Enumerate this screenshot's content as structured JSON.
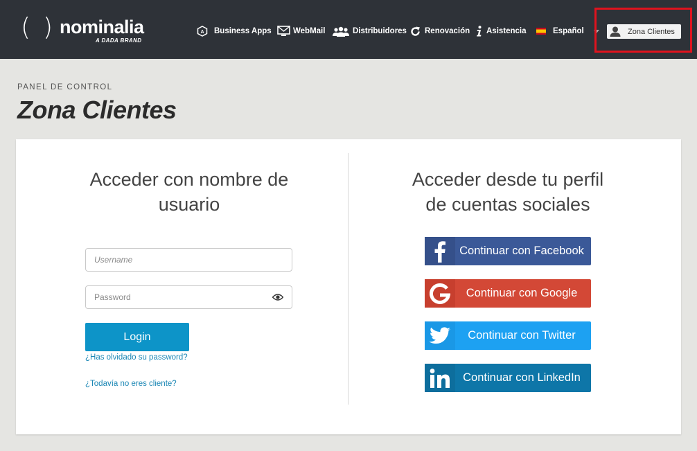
{
  "header": {
    "logo_text": "nominalia",
    "logo_tagline": "A DADA BRAND",
    "nav": [
      {
        "label": "Business Apps",
        "icon": "business-apps-icon"
      },
      {
        "label": "WebMail",
        "icon": "mail-icon"
      },
      {
        "label": "Distribuidores",
        "icon": "users-icon"
      },
      {
        "label": "Renovación",
        "icon": "refresh-icon"
      },
      {
        "label": "Asistencia",
        "icon": "info-icon"
      }
    ],
    "language": {
      "label": "Español",
      "icon": "spain-flag-icon"
    },
    "account_button": {
      "label": "Zona Clientes",
      "icon": "user-icon"
    },
    "highlight_color": "#e0131e"
  },
  "page": {
    "eyebrow": "PANEL DE CONTROL",
    "title": "Zona Clientes"
  },
  "login": {
    "heading_line1": "Acceder con nombre de",
    "heading_line2": "usuario",
    "username_placeholder": "Username",
    "password_placeholder": "Password",
    "login_label": "Login",
    "forgot_link": "¿Has olvidado su password?",
    "not_client_link": "¿Todavía no eres cliente?"
  },
  "social": {
    "heading_line1": "Acceder desde tu perfil",
    "heading_line2": "de cuentas sociales",
    "buttons": [
      {
        "label": "Continuar con Facebook",
        "icon": "facebook-icon",
        "color": "#3b5998"
      },
      {
        "label": "Continuar con Google",
        "icon": "google-icon",
        "color": "#d34836"
      },
      {
        "label": "Continuar con Twitter",
        "icon": "twitter-icon",
        "color": "#1da1f2"
      },
      {
        "label": "Continuar con LinkedIn",
        "icon": "linkedin-icon",
        "color": "#0e76a8"
      }
    ]
  }
}
